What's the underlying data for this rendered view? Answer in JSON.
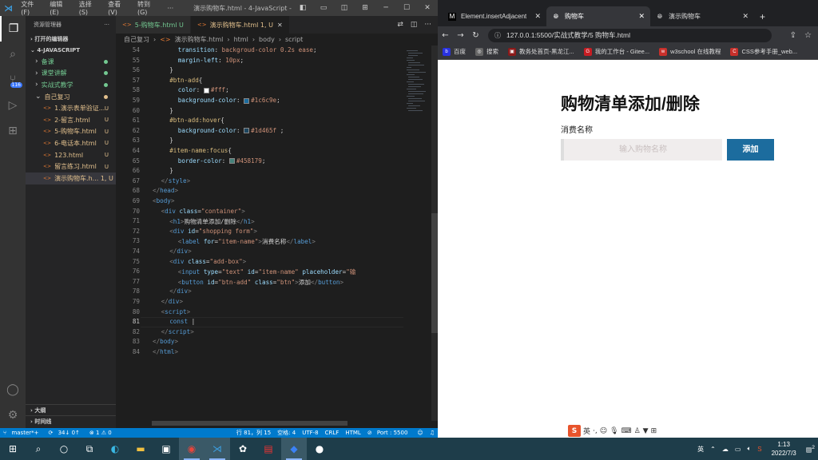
{
  "vscode": {
    "menu": [
      "文件(F)",
      "编辑(E)",
      "选择(S)",
      "查看(V)",
      "转到(G)",
      "···"
    ],
    "window_title": "演示购物车.html - 4-JavaScript - Vi...",
    "explorer_title": "资源管理器",
    "open_editors_label": "打开的编辑器",
    "folder_label": "4-JAVASCRIPT",
    "scm_badge": "116",
    "tree": [
      {
        "label": "备课",
        "color": "#73c991",
        "indent": 12,
        "marker": "dot"
      },
      {
        "label": "课堂讲解",
        "color": "#73c991",
        "indent": 12,
        "marker": "dot"
      },
      {
        "label": "实战式教学",
        "color": "#73c991",
        "indent": 12,
        "marker": "dot"
      },
      {
        "label": "自己复习",
        "color": "#e2c08d",
        "indent": 12,
        "marker": "dot",
        "open": true
      },
      {
        "label": "1.演示表单验证...",
        "color": "#e2c08d",
        "indent": 22,
        "marker": "U"
      },
      {
        "label": "2-留言.html",
        "color": "#e2c08d",
        "indent": 22,
        "marker": "U"
      },
      {
        "label": "5-购物车.html",
        "color": "#e2c08d",
        "indent": 22,
        "marker": "U"
      },
      {
        "label": "6-电话本.html",
        "color": "#e2c08d",
        "indent": 22,
        "marker": "U"
      },
      {
        "label": "123.html",
        "color": "#e2c08d",
        "indent": 22,
        "marker": "U"
      },
      {
        "label": "留言练习.html",
        "color": "#e2c08d",
        "indent": 22,
        "marker": "U"
      },
      {
        "label": "演示购物车.h... 1, U",
        "color": "#e2c08d",
        "indent": 22,
        "marker": "",
        "selected": true
      }
    ],
    "outline_label": "大纲",
    "timeline_label": "时间线",
    "tabs": [
      {
        "label": "5-购物车.html U",
        "active": false
      },
      {
        "label": "演示购物车.html 1, U",
        "active": true
      }
    ],
    "breadcrumbs": [
      "自己复习",
      "›",
      "演示购物车.html",
      "›",
      "html",
      "›",
      "body",
      "›",
      "script"
    ],
    "status": {
      "branch": "master*+",
      "sync": "34↓ 0↑",
      "problems": "⊗ 1 ⚠ 0",
      "position": "行 81，列 15",
      "spaces": "空格: 4",
      "encoding": "UTF-8",
      "eol": "CRLF",
      "language": "HTML",
      "port": "Port : 5500"
    }
  },
  "code_lines": [
    {
      "n": "54",
      "html": "<span class='pr'>transition</span><span class='p'>: </span><span class='v'>backgroud-color 0.2s ease</span><span class='p'>;</span>",
      "indent": 6
    },
    {
      "n": "55",
      "html": "<span class='pr'>margin-left</span><span class='p'>: </span><span class='v'>10px</span><span class='p'>;</span>",
      "indent": 6
    },
    {
      "n": "56",
      "html": "<span class='p'>}</span>",
      "indent": 4
    },
    {
      "n": "57",
      "html": "<span class='sel'>#btn-add</span><span class='p'>{</span>",
      "indent": 4
    },
    {
      "n": "58",
      "html": "<span class='pr'>color</span><span class='p'>: </span><span class='sw' style='background:#fff'></span><span class='v'>#fff</span><span class='p'>;</span>",
      "indent": 6
    },
    {
      "n": "59",
      "html": "<span class='pr'>background-color</span><span class='p'>: </span><span class='sw' style='background:#1c6c9e'></span><span class='v'>#1c6c9e</span><span class='p'>;</span>",
      "indent": 6
    },
    {
      "n": "60",
      "html": "<span class='p'>}</span>",
      "indent": 4
    },
    {
      "n": "61",
      "html": "<span class='sel'>#btn-add:hover</span><span class='p'>{</span>",
      "indent": 4
    },
    {
      "n": "62",
      "html": "<span class='pr'>background-color</span><span class='p'>: </span><span class='sw' style='background:#1d465f'></span><span class='v'>#1d465f</span><span class='p'> ;</span>",
      "indent": 6
    },
    {
      "n": "63",
      "html": "<span class='p'>}</span>",
      "indent": 4
    },
    {
      "n": "64",
      "html": "<span class='sel'>#item-name:focus</span><span class='p'>{</span>",
      "indent": 4
    },
    {
      "n": "65",
      "html": "<span class='pr'>border-color</span><span class='p'>: </span><span class='sw' style='background:#458179'></span><span class='v'>#458179</span><span class='p'>;</span>",
      "indent": 6
    },
    {
      "n": "66",
      "html": "<span class='p'>}</span>",
      "indent": 4
    },
    {
      "n": "67",
      "html": "<span class='x'>&lt;/</span><span class='t'>style</span><span class='x'>&gt;</span>",
      "indent": 2
    },
    {
      "n": "68",
      "html": "<span class='x'>&lt;/</span><span class='t'>head</span><span class='x'>&gt;</span>",
      "indent": 0
    },
    {
      "n": "69",
      "html": "<span class='x'>&lt;</span><span class='t'>body</span><span class='x'>&gt;</span>",
      "indent": 0
    },
    {
      "n": "70",
      "html": "<span class='x'>&lt;</span><span class='t'>div</span> <span class='a'>class</span><span class='p'>=</span><span class='s'>\"container\"</span><span class='x'>&gt;</span>",
      "indent": 2
    },
    {
      "n": "71",
      "html": "<span class='x'>&lt;</span><span class='t'>h1</span><span class='x'>&gt;</span><span class='p'>购物清单添加/删除</span><span class='x'>&lt;/</span><span class='t'>h1</span><span class='x'>&gt;</span>",
      "indent": 4
    },
    {
      "n": "72",
      "html": "<span class='x'>&lt;</span><span class='t'>div</span> <span class='a'>id</span><span class='p'>=</span><span class='s'>\"shopping form\"</span><span class='x'>&gt;</span>",
      "indent": 4
    },
    {
      "n": "73",
      "html": "<span class='x'>&lt;</span><span class='t'>label</span> <span class='a'>for</span><span class='p'>=</span><span class='s'>\"item-name\"</span><span class='x'>&gt;</span><span class='p'>消费名称</span><span class='x'>&lt;/</span><span class='t'>label</span><span class='x'>&gt;</span>",
      "indent": 6
    },
    {
      "n": "74",
      "html": "<span class='x'>&lt;/</span><span class='t'>div</span><span class='x'>&gt;</span>",
      "indent": 4
    },
    {
      "n": "75",
      "html": "<span class='x'>&lt;</span><span class='t'>div</span> <span class='a'>class</span><span class='p'>=</span><span class='s'>\"add-box\"</span><span class='x'>&gt;</span>",
      "indent": 4
    },
    {
      "n": "76",
      "html": "<span class='x'>&lt;</span><span class='t'>input</span> <span class='a'>type</span><span class='p'>=</span><span class='s'>\"text\"</span> <span class='a'>id</span><span class='p'>=</span><span class='s'>\"item-name\"</span> <span class='a'>placeholder</span><span class='p'>=</span><span class='s'>\"输</span>",
      "indent": 6
    },
    {
      "n": "77",
      "html": "<span class='x'>&lt;</span><span class='t'>button</span> <span class='a'>id</span><span class='p'>=</span><span class='s'>\"btn-add\"</span> <span class='a'>class</span><span class='p'>=</span><span class='s'>\"btn\"</span><span class='x'>&gt;</span><span class='p'>添加</span><span class='x'>&lt;/</span><span class='t'>button</span><span class='x'>&gt;</span>",
      "indent": 6
    },
    {
      "n": "78",
      "html": "<span class='x'>&lt;/</span><span class='t'>div</span><span class='x'>&gt;</span>",
      "indent": 4
    },
    {
      "n": "79",
      "html": "<span class='x'>&lt;/</span><span class='t'>div</span><span class='x'>&gt;</span>",
      "indent": 2
    },
    {
      "n": "80",
      "html": "<span class='x'>&lt;</span><span class='t'>script</span><span class='x'>&gt;</span>",
      "indent": 2
    },
    {
      "n": "81",
      "html": "<span class='k'>const</span> <span class='p'>|</span>",
      "indent": 4,
      "current": true
    },
    {
      "n": "82",
      "html": "<span class='x'>&lt;/</span><span class='t'>script</span><span class='x'>&gt;</span>",
      "indent": 2
    },
    {
      "n": "83",
      "html": "<span class='x'>&lt;/</span><span class='t'>body</span><span class='x'>&gt;</span>",
      "indent": 0
    },
    {
      "n": "84",
      "html": "<span class='x'>&lt;/</span><span class='t'>html</span><span class='x'>&gt;</span>",
      "indent": 0
    }
  ],
  "browser": {
    "tabs": [
      {
        "label": "Element.insertAdjacent",
        "icon": "M",
        "active": false
      },
      {
        "label": "购物车",
        "icon": "globe",
        "active": true
      },
      {
        "label": "演示购物车",
        "icon": "globe",
        "active": false
      }
    ],
    "url": "127.0.0.1:5500/实战式教学/5 购物车.html",
    "bookmarks": [
      {
        "label": "百度",
        "color": "#2932e1",
        "glyph": "b"
      },
      {
        "label": "搜索",
        "color": "#666",
        "glyph": "◎"
      },
      {
        "label": "教务处首页-黑龙江...",
        "color": "#8b1a1a",
        "glyph": "▣"
      },
      {
        "label": "我的工作台 - Gitee...",
        "color": "#c71d23",
        "glyph": "G"
      },
      {
        "label": "w3school 在线教程",
        "color": "#c8302b",
        "glyph": "w"
      },
      {
        "label": "CSS参考手册_web...",
        "color": "#c8302b",
        "glyph": "C"
      }
    ],
    "page": {
      "heading": "购物清单添加/删除",
      "label": "消费名称",
      "input_placeholder": "输入购物名称",
      "button": "添加"
    },
    "ime_label": "英"
  },
  "taskbar": {
    "tray_lang": "英",
    "time": "1:13",
    "date": "2022/7/3",
    "notification_count": "2"
  },
  "colors": {
    "accent": "#007acc",
    "button": "#1c6c9e",
    "taskbar": "#1e3d4a"
  }
}
